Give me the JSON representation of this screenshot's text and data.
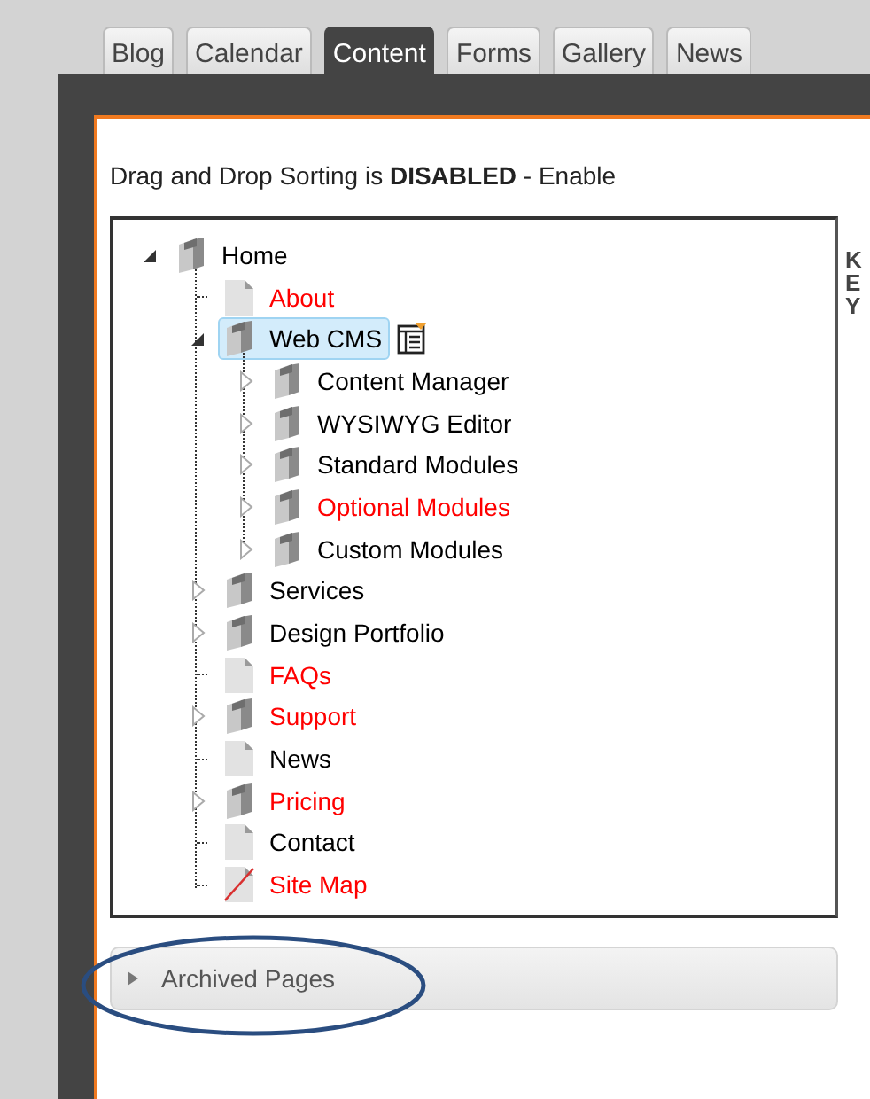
{
  "tabs": [
    {
      "label": "Blog",
      "selected": false
    },
    {
      "label": "Calendar",
      "selected": false
    },
    {
      "label": "Content",
      "selected": true
    },
    {
      "label": "Forms",
      "selected": false
    },
    {
      "label": "Gallery",
      "selected": false
    },
    {
      "label": "News",
      "selected": false
    }
  ],
  "sorting_notice": "Drag and Drop Sorting is **DISABLED** - Enable",
  "key_label": "KEY",
  "tree": [
    {
      "label": "Home",
      "kind": "folder",
      "expanded": true,
      "selected": false,
      "color": "#000000",
      "children": [
        {
          "label": "About",
          "kind": "page",
          "selected": false,
          "color": "#ff0000"
        },
        {
          "label": "Web CMS",
          "kind": "folder",
          "expanded": true,
          "selected": true,
          "color": "#000000",
          "children": [
            {
              "label": "Content Manager",
              "kind": "folder",
              "expanded": false,
              "selected": false,
              "color": "#000000"
            },
            {
              "label": "WYSIWYG Editor",
              "kind": "folder",
              "expanded": false,
              "selected": false,
              "color": "#000000"
            },
            {
              "label": "Standard Modules",
              "kind": "folder",
              "expanded": false,
              "selected": false,
              "color": "#000000"
            },
            {
              "label": "Optional Modules",
              "kind": "folder",
              "expanded": false,
              "selected": false,
              "color": "#ff0000"
            },
            {
              "label": "Custom Modules",
              "kind": "folder",
              "expanded": false,
              "selected": false,
              "color": "#000000"
            }
          ]
        },
        {
          "label": "Services",
          "kind": "folder",
          "expanded": false,
          "selected": false,
          "color": "#000000"
        },
        {
          "label": "Design Portfolio",
          "kind": "folder",
          "expanded": false,
          "selected": false,
          "color": "#000000"
        },
        {
          "label": "FAQs",
          "kind": "page",
          "selected": false,
          "color": "#ff0000"
        },
        {
          "label": "Support",
          "kind": "folder",
          "expanded": false,
          "selected": false,
          "color": "#ff0000"
        },
        {
          "label": "News",
          "kind": "page",
          "selected": false,
          "color": "#000000"
        },
        {
          "label": "Pricing",
          "kind": "folder",
          "expanded": false,
          "selected": false,
          "color": "#ff0000"
        },
        {
          "label": "Contact",
          "kind": "page",
          "selected": false,
          "color": "#000000"
        },
        {
          "label": "Site Map",
          "kind": "sitemap",
          "selected": false,
          "color": "#ff0000"
        }
      ]
    }
  ],
  "archive_panel": {
    "label": "Archived Pages",
    "expanded": false
  }
}
